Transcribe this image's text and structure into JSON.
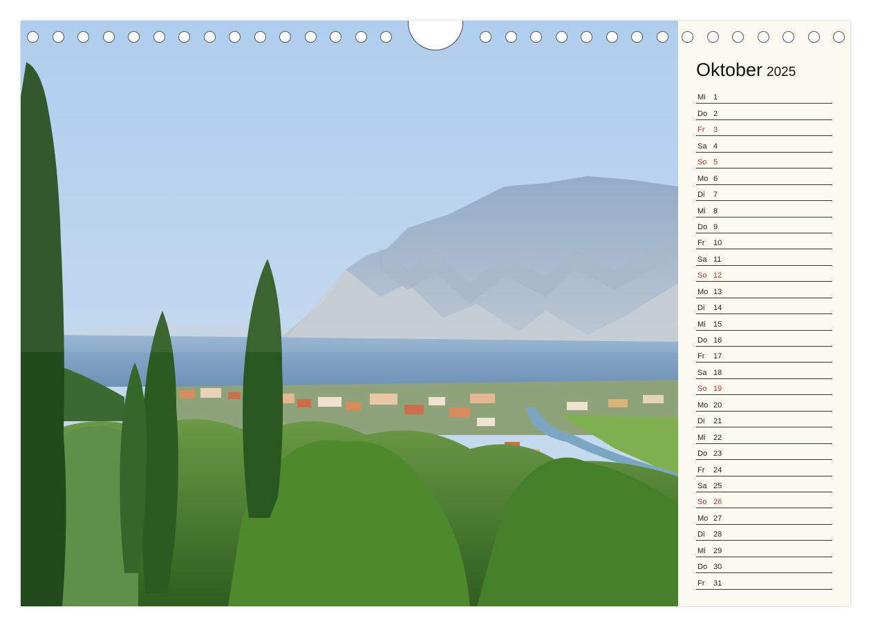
{
  "calendar": {
    "month": "Oktober",
    "year": "2025",
    "days": [
      {
        "wd": "Mi",
        "d": "1",
        "weekend": false
      },
      {
        "wd": "Do",
        "d": "2",
        "weekend": false
      },
      {
        "wd": "Fr",
        "d": "3",
        "weekend": true
      },
      {
        "wd": "Sa",
        "d": "4",
        "weekend": false
      },
      {
        "wd": "So",
        "d": "5",
        "weekend": true
      },
      {
        "wd": "Mo",
        "d": "6",
        "weekend": false
      },
      {
        "wd": "Di",
        "d": "7",
        "weekend": false
      },
      {
        "wd": "Mi",
        "d": "8",
        "weekend": false
      },
      {
        "wd": "Do",
        "d": "9",
        "weekend": false
      },
      {
        "wd": "Fr",
        "d": "10",
        "weekend": false
      },
      {
        "wd": "Sa",
        "d": "11",
        "weekend": false
      },
      {
        "wd": "So",
        "d": "12",
        "weekend": true
      },
      {
        "wd": "Mo",
        "d": "13",
        "weekend": false
      },
      {
        "wd": "Di",
        "d": "14",
        "weekend": false
      },
      {
        "wd": "Mi",
        "d": "15",
        "weekend": false
      },
      {
        "wd": "Do",
        "d": "16",
        "weekend": false
      },
      {
        "wd": "Fr",
        "d": "17",
        "weekend": false
      },
      {
        "wd": "Sa",
        "d": "18",
        "weekend": false
      },
      {
        "wd": "So",
        "d": "19",
        "weekend": true
      },
      {
        "wd": "Mo",
        "d": "20",
        "weekend": false
      },
      {
        "wd": "Di",
        "d": "21",
        "weekend": false
      },
      {
        "wd": "Mi",
        "d": "22",
        "weekend": false
      },
      {
        "wd": "Do",
        "d": "23",
        "weekend": false
      },
      {
        "wd": "Fr",
        "d": "24",
        "weekend": false
      },
      {
        "wd": "Sa",
        "d": "25",
        "weekend": false
      },
      {
        "wd": "So",
        "d": "26",
        "weekend": true
      },
      {
        "wd": "Mo",
        "d": "27",
        "weekend": false
      },
      {
        "wd": "Di",
        "d": "28",
        "weekend": false
      },
      {
        "wd": "Mi",
        "d": "29",
        "weekend": false
      },
      {
        "wd": "Do",
        "d": "30",
        "weekend": false
      },
      {
        "wd": "Fr",
        "d": "31",
        "weekend": false
      }
    ]
  },
  "colors": {
    "panel_background": "#fbf9f0",
    "holiday_text": "#c0302c",
    "sky": "#b9d4ee",
    "lake": "#7fa2c4",
    "foliage": "#3f7d2a"
  },
  "photo": {
    "icon": "landscape-photo-icon"
  }
}
